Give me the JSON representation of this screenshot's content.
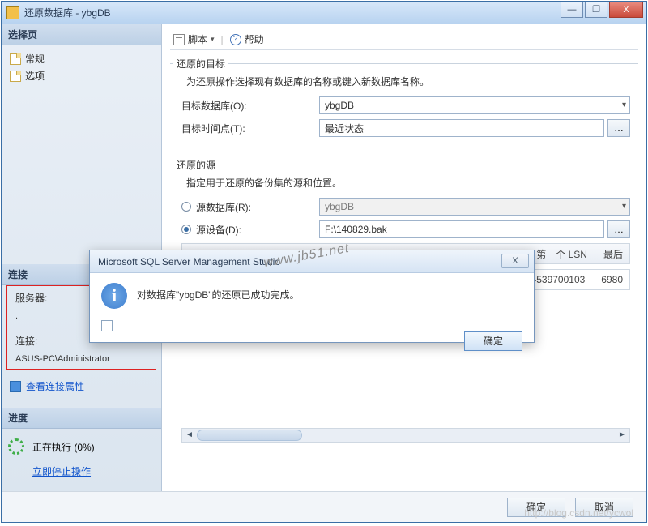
{
  "window": {
    "title": "还原数据库 - ybgDB"
  },
  "winbtns": {
    "min": "—",
    "max": "❐",
    "close": "X"
  },
  "left": {
    "pages_hdr": "选择页",
    "page_general": "常规",
    "page_options": "选项",
    "conn_hdr": "连接",
    "server_label": "服务器:",
    "server_value": ".",
    "conn_label": "连接:",
    "conn_value": "ASUS-PC\\Administrator",
    "view_conn_props": "查看连接属性",
    "progress_hdr": "进度",
    "progress_text": "正在执行 (0%)",
    "stop_action": "立即停止操作"
  },
  "toolbar": {
    "script": "脚本",
    "help": "帮助"
  },
  "dest": {
    "legend": "还原的目标",
    "hint": "为还原操作选择现有数据库的名称或键入新数据库名称。",
    "db_label": "目标数据库(O):",
    "db_value": "ybgDB",
    "time_label": "目标时间点(T):",
    "time_value": "最近状态"
  },
  "source": {
    "legend": "还原的源",
    "hint": "指定用于还原的备份集的源和位置。",
    "from_db_label": "源数据库(R):",
    "from_db_value": "ybgDB",
    "from_device_label": "源设备(D):",
    "from_device_value": "F:\\140829.bak"
  },
  "grid": {
    "col_first_lsn": "第一个 LSN",
    "col_last": "最后",
    "val_first_lsn": "59800000004539700103",
    "val_last": "6980"
  },
  "footer": {
    "ok": "确定",
    "cancel": "取消"
  },
  "msgbox": {
    "title": "Microsoft SQL Server Management Studio",
    "text": "对数据库\"ybgDB\"的还原已成功完成。",
    "ok": "确定",
    "close": "X"
  },
  "watermark": "www.jb51.net",
  "watermark2": "http://blog.csdn.net/ycwol"
}
